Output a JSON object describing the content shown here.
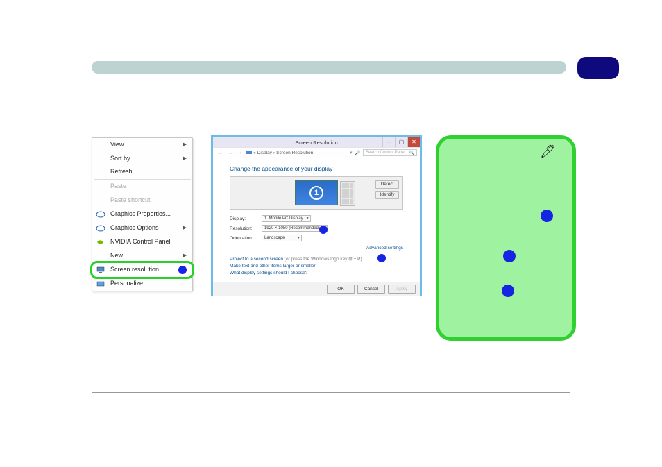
{
  "header": {
    "title": ""
  },
  "context_menu": {
    "items": [
      {
        "label": "View",
        "submenu": true
      },
      {
        "label": "Sort by",
        "submenu": true
      },
      {
        "label": "Refresh"
      },
      {
        "sep": true
      },
      {
        "label": "Paste",
        "disabled": true
      },
      {
        "label": "Paste shortcut",
        "disabled": true
      },
      {
        "sep": true
      },
      {
        "label": "Graphics Properties...",
        "icon": "intel"
      },
      {
        "label": "Graphics Options",
        "submenu": true,
        "icon": "intel"
      },
      {
        "label": "NVIDIA Control Panel",
        "icon": "nvidia"
      },
      {
        "label": "New",
        "submenu": true
      },
      {
        "sep": true
      },
      {
        "label": "Screen resolution",
        "icon": "display",
        "highlight": true
      },
      {
        "label": "Personalize",
        "icon": "personalize"
      }
    ]
  },
  "dialog": {
    "title": "Screen Resolution",
    "breadcrumb": {
      "a": "Display",
      "b": "Screen Resolution"
    },
    "search_placeholder": "Search Control Panel",
    "heading": "Change the appearance of your display",
    "detect": "Detect",
    "identify": "Identify",
    "monitor_number": "1",
    "fields": {
      "display_label": "Display:",
      "display_value": "1. Mobile PC Display",
      "resolution_label": "Resolution:",
      "resolution_value": "1920 × 1080 (Recommended)",
      "orientation_label": "Orientation:",
      "orientation_value": "Landscape"
    },
    "advanced": "Advanced settings",
    "project_link": "Project to a second screen",
    "project_hint": "(or press the Windows logo key ⊞ + P)",
    "larger_link": "Make text and other items larger or smaller",
    "what_link": "What display settings should I choose?",
    "buttons": {
      "ok": "OK",
      "cancel": "Cancel",
      "apply": "Apply"
    }
  }
}
